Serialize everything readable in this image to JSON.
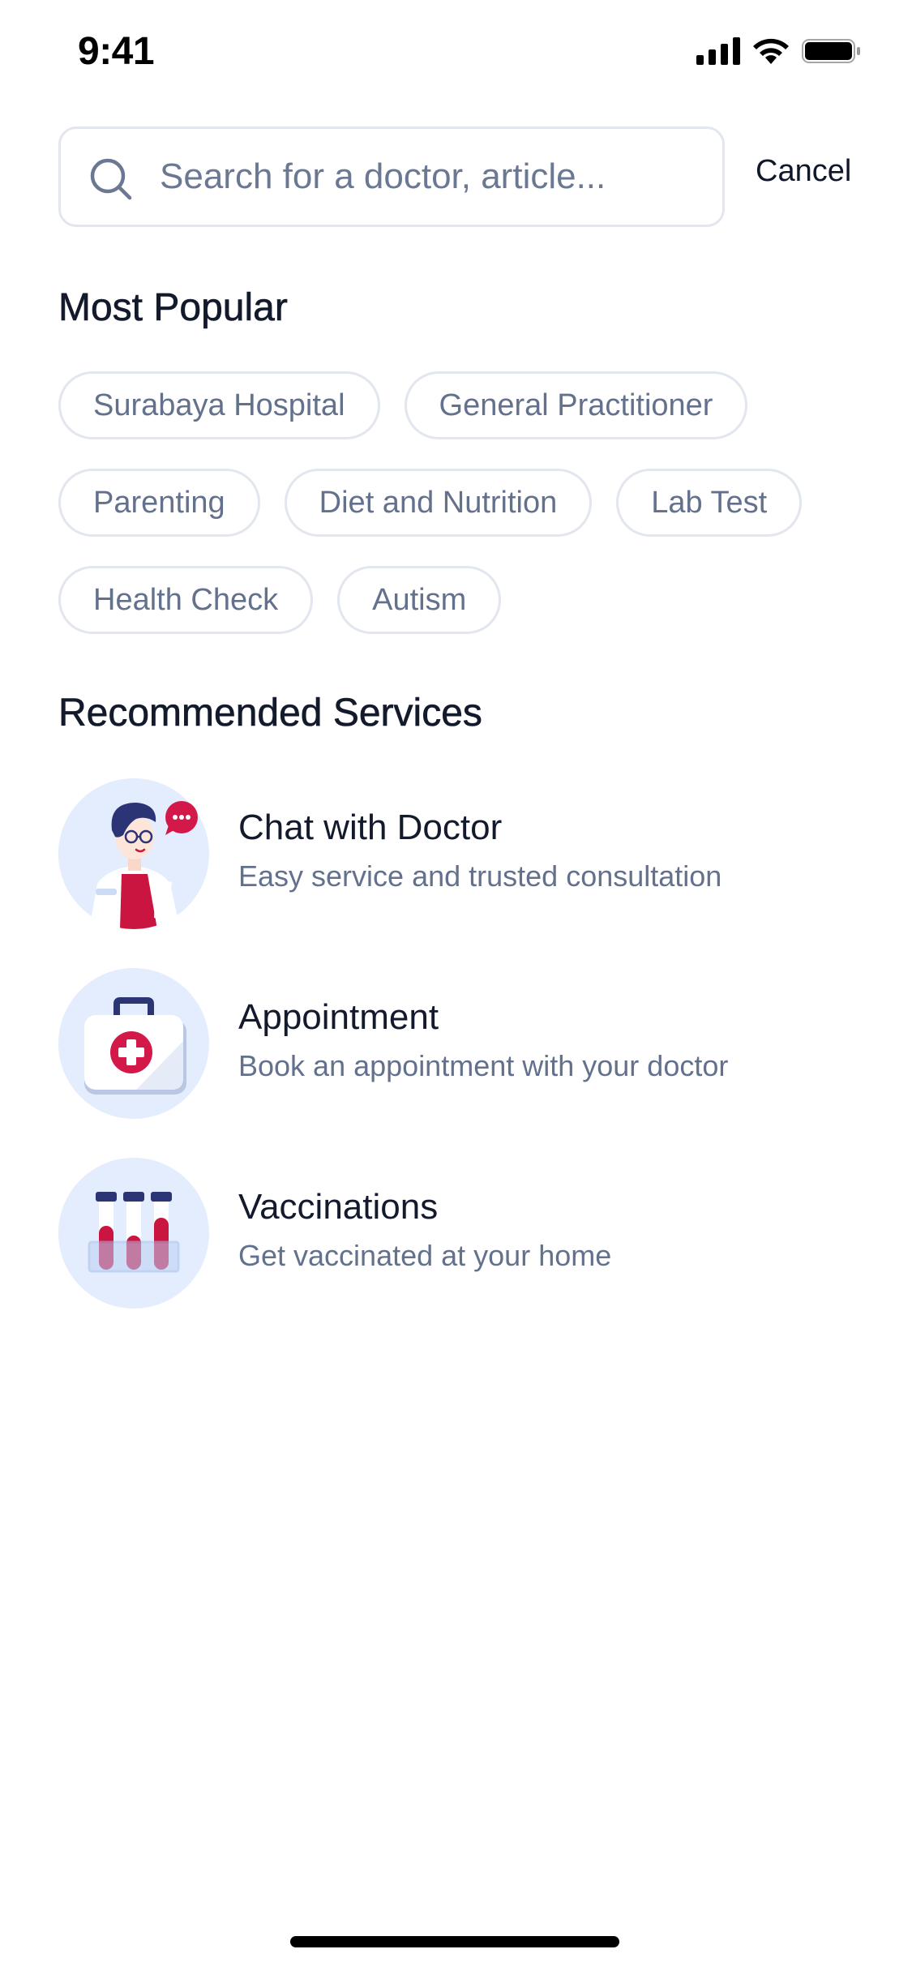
{
  "status_bar": {
    "time": "9:41",
    "icons": [
      "signal-icon",
      "wifi-icon",
      "battery-icon"
    ]
  },
  "search": {
    "placeholder": "Search for a doctor, article...",
    "value": "",
    "cancel_label": "Cancel"
  },
  "most_popular": {
    "title": "Most Popular",
    "chips": [
      "Surabaya Hospital",
      "General Practitioner",
      "Parenting",
      "Diet and Nutrition",
      "Lab Test",
      "Health Check",
      "Autism"
    ]
  },
  "recommended": {
    "title": "Recommended Services",
    "services": [
      {
        "title": "Chat with Doctor",
        "description": "Easy service and trusted consultation",
        "icon": "doctor-chat-icon"
      },
      {
        "title": "Appointment",
        "description": "Book an appointment with your doctor",
        "icon": "medical-kit-icon"
      },
      {
        "title": "Vaccinations",
        "description": "Get vaccinated at your home",
        "icon": "test-tubes-icon"
      }
    ]
  },
  "colors": {
    "accent_red": "#d2194a",
    "navy": "#2b3475",
    "light_blue": "#e3edfd",
    "border": "#e2e6ee",
    "muted_text": "#63718d"
  }
}
